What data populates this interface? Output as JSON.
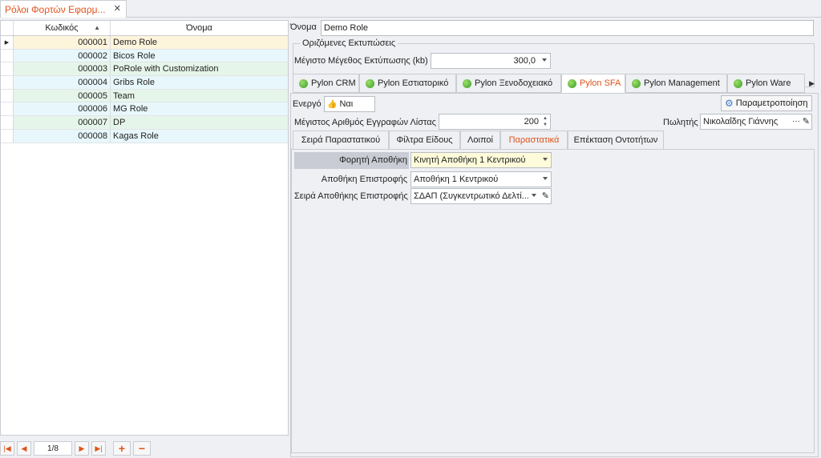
{
  "doc_tab": {
    "title": "Ρόλοι Φορτών Εφαρμ...",
    "close": "✕"
  },
  "grid": {
    "columns": {
      "code": "Κωδικός",
      "name": "Όνομα"
    },
    "rows": [
      {
        "code": "000001",
        "name": "Demo Role"
      },
      {
        "code": "000002",
        "name": "Bicos Role"
      },
      {
        "code": "000003",
        "name": "PoRole with Customization"
      },
      {
        "code": "000004",
        "name": "Gribs Role"
      },
      {
        "code": "000005",
        "name": "Team"
      },
      {
        "code": "000006",
        "name": "MG Role"
      },
      {
        "code": "000007",
        "name": "DP"
      },
      {
        "code": "000008",
        "name": "Kagas Role"
      }
    ]
  },
  "navigator": {
    "count": "1/8"
  },
  "form": {
    "name_label": "Όνομα",
    "name_value": "Demo Role",
    "print_group_title": "Οριζόμενες Εκτυπώσεις",
    "max_print_label": "Μέγιστο Μέγεθος Εκτύπωσης (kb)",
    "max_print_value": "300,0",
    "top_tabs": [
      "Pylon CRM",
      "Pylon Εστιατορικό",
      "Pylon Ξενοδοχειακό",
      "Pylon SFA",
      "Pylon Management",
      "Pylon Ware"
    ],
    "active_label": "Ενεργό",
    "active_value": "Ναι",
    "settings_button": "Παραμετροποίηση",
    "max_records_label": "Μέγιστος Αριθμός Εγγραφών Λίστας",
    "max_records_value": "200",
    "seller_label": "Πωλητής",
    "seller_value": "Νικολαΐδης Γιάννης",
    "seller_dots": "···",
    "inner_tabs": [
      "Σειρά Παραστατικού",
      "Φίλτρα Είδους",
      "Λοιποί",
      "Παραστατικά",
      "Επέκταση Οντοτήτων"
    ],
    "store_label": "Φορητή Αποθήκη",
    "store_value": "Κινητή Αποθήκη 1 Κεντρικού",
    "return_store_label": "Αποθήκη Επιστροφής",
    "return_store_value": "Αποθήκη 1 Κεντρικού",
    "return_series_label": "Σειρά Αποθήκης Επιστροφής",
    "return_series_value": "ΣΔΑΠ (Συγκεντρωτικό Δελτί..."
  },
  "colors": {
    "accent": "#e0521d",
    "selected_row": "#fdf4dc",
    "row_blue": "#e8f7fb",
    "row_green": "#e6f5e9"
  }
}
